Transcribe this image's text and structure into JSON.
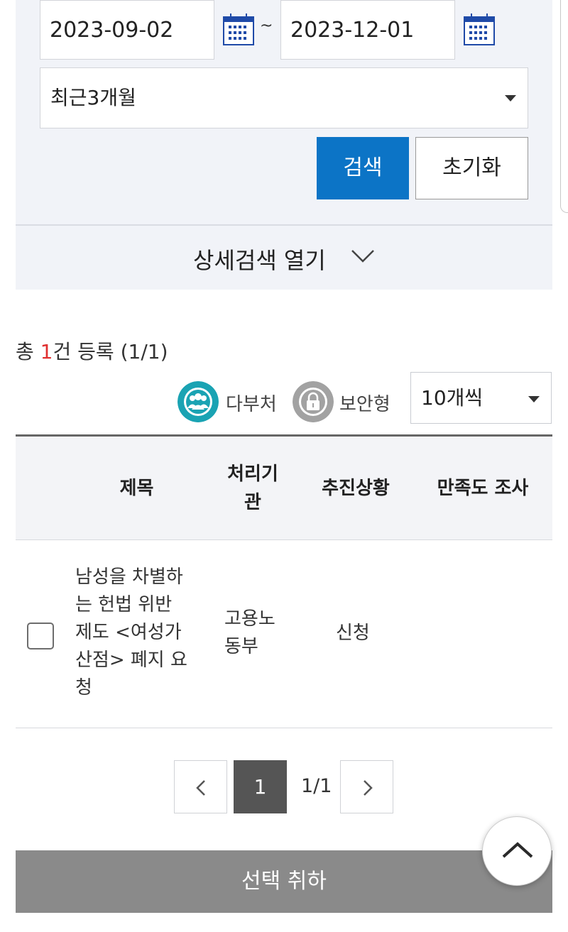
{
  "search": {
    "start_date": "2023-09-02",
    "end_date": "2023-12-01",
    "date_separator": "~",
    "calendar_icon": "calendar-icon",
    "period_selected": "최근3개월",
    "search_label": "검색",
    "reset_label": "초기화",
    "detail_toggle_label": "상세검색 열기",
    "accent_color": "#0c74c6"
  },
  "summary": {
    "prefix": "총 ",
    "count": "1",
    "suffix": "건 등록 (1/1)",
    "count_color": "#e03030"
  },
  "legend": {
    "multi_dept_label": "다부처",
    "multi_dept_icon": "group-icon",
    "multi_dept_color": "#1aa3b3",
    "secure_label": "보안형",
    "secure_icon": "lock-icon",
    "secure_color": "#9a9a9a",
    "per_page_selected": "10개씩"
  },
  "table": {
    "headers": {
      "title": "제목",
      "agency_line1": "처리기",
      "agency_line2": "관",
      "status": "추진상황",
      "survey": "만족도 조사"
    },
    "rows": [
      {
        "title_lines": [
          "남성을 차별하",
          "는 헌법 위반",
          "제도 <여성가",
          "산점> 폐지 요",
          "청"
        ],
        "agency_lines": [
          "고용노",
          "동부"
        ],
        "status": "신청",
        "survey": ""
      }
    ]
  },
  "pagination": {
    "current": "1",
    "info": "1/1",
    "prev_icon": "chevron-left-icon",
    "next_icon": "chevron-right-icon"
  },
  "actions": {
    "cancel_selection_label": "선택 취하",
    "scroll_top_icon": "chevron-up-icon"
  }
}
